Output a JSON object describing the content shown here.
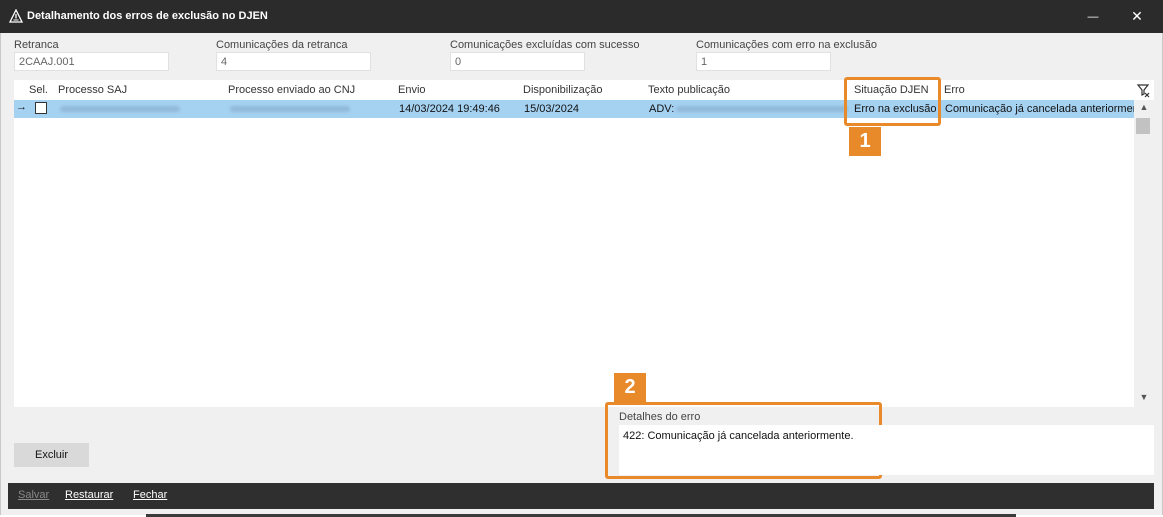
{
  "window": {
    "title": "Detalhamento dos erros de exclusão no DJEN",
    "minimize_glyph": "—",
    "close_glyph": "✕",
    "app_icon": "warning-triangle-icon"
  },
  "fields": {
    "retranca": {
      "label": "Retranca",
      "value": "2CAAJ.001"
    },
    "comunicacoes": {
      "label": "Comunicações da retranca",
      "value": "4"
    },
    "sucesso": {
      "label": "Comunicações excluídas com sucesso",
      "value": "0"
    },
    "erro": {
      "label": "Comunicações com erro na exclusão",
      "value": "1"
    }
  },
  "grid": {
    "columns": [
      "Sel.",
      "Processo SAJ",
      "Processo enviado ao CNJ",
      "Envio",
      "Disponibilização",
      "Texto publicação",
      "Situação DJEN",
      "Erro"
    ],
    "rows": [
      {
        "arrow": "→",
        "envio": "14/03/2024 19:49:46",
        "disponibilizacao": "15/03/2024",
        "texto": "ADV:",
        "situacao": "Erro na exclusão",
        "erro": "Comunicação já cancelada anteriormente."
      }
    ],
    "scroll_up": "▲",
    "scroll_down": "▼"
  },
  "callouts": {
    "one": "1",
    "two": "2"
  },
  "details": {
    "label": "Detalhes do erro",
    "text": "422: Comunicação já cancelada anteriormente."
  },
  "actions": {
    "excluir": "Excluir"
  },
  "bottombar": {
    "salvar": "Salvar",
    "restaurar": "Restaurar",
    "fechar": "Fechar"
  },
  "colors": {
    "accent": "#e8892a",
    "row_selected": "#a6d2f2",
    "titlebar": "#2b2b2b"
  }
}
